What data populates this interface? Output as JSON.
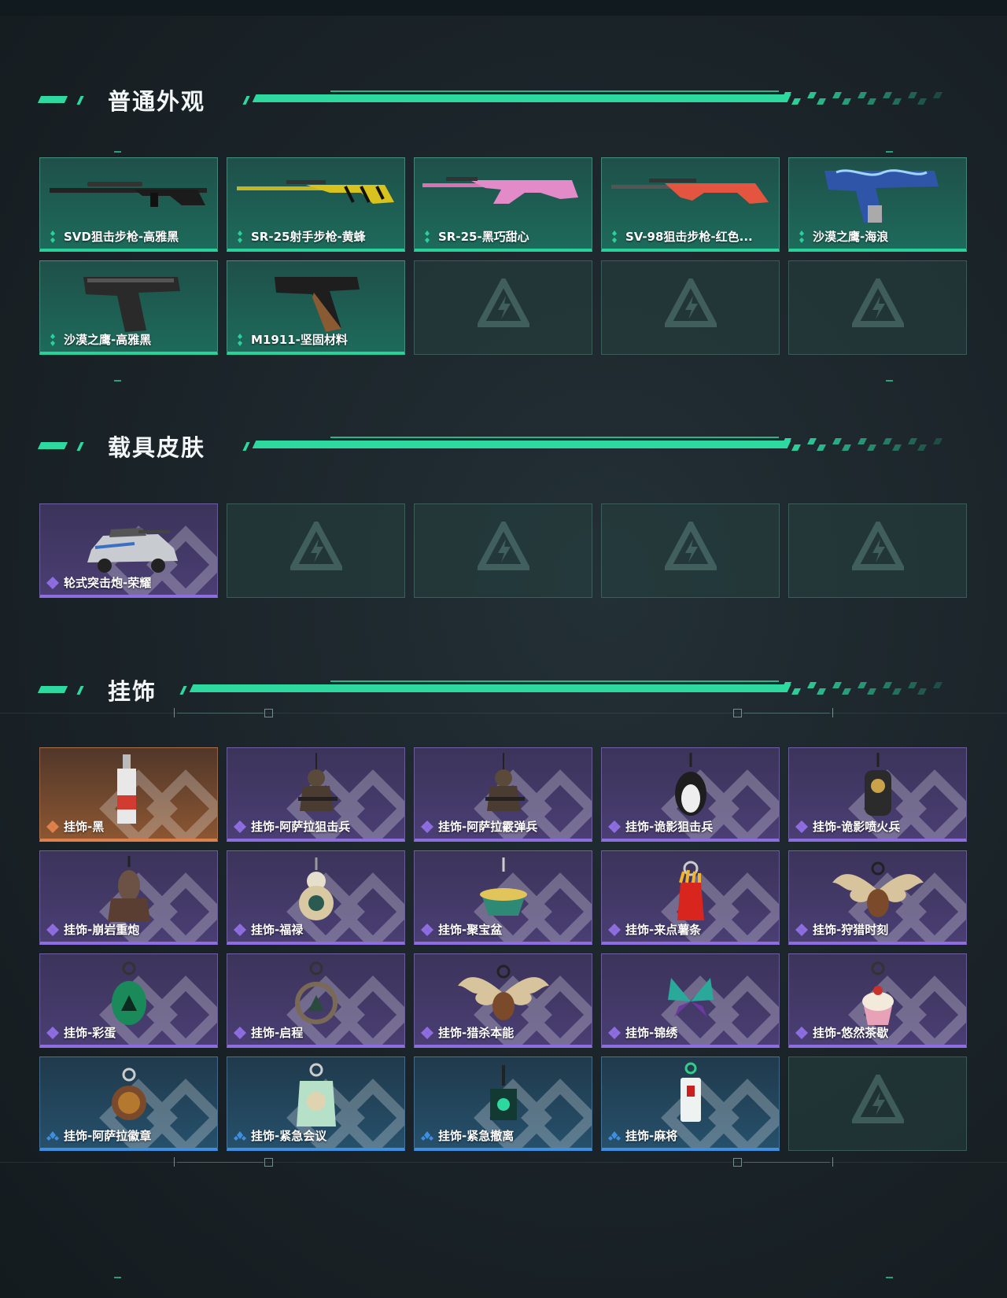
{
  "sections": [
    {
      "title": "普通外观",
      "items": [
        {
          "label": "SVD狙击步枪-高雅黑",
          "rarity": "green",
          "icon": "sniper-rifle-black"
        },
        {
          "label": "SR-25射手步枪-黄蜂",
          "rarity": "green",
          "icon": "rifle-yellow-hornet"
        },
        {
          "label": "SR-25-黑巧甜心",
          "rarity": "green",
          "icon": "rifle-pink"
        },
        {
          "label": "SV-98狙击步枪-红色...",
          "rarity": "green",
          "icon": "sniper-rifle-red"
        },
        {
          "label": "沙漠之鹰-海浪",
          "rarity": "green",
          "icon": "pistol-blue-wave"
        },
        {
          "label": "沙漠之鹰-高雅黑",
          "rarity": "green",
          "icon": "pistol-black"
        },
        {
          "label": "M1911-坚固材料",
          "rarity": "green",
          "icon": "pistol-m1911"
        },
        {
          "label": "",
          "rarity": "empty"
        },
        {
          "label": "",
          "rarity": "empty"
        },
        {
          "label": "",
          "rarity": "empty"
        }
      ]
    },
    {
      "title": "载具皮肤",
      "items": [
        {
          "label": "轮式突击炮-荣耀",
          "rarity": "purple",
          "icon": "armored-vehicle"
        },
        {
          "label": "",
          "rarity": "empty"
        },
        {
          "label": "",
          "rarity": "empty"
        },
        {
          "label": "",
          "rarity": "empty"
        },
        {
          "label": "",
          "rarity": "empty"
        }
      ]
    },
    {
      "title": "挂饰",
      "items": [
        {
          "label": "挂饰-黑",
          "rarity": "orange",
          "icon": "charm-tag"
        },
        {
          "label": "挂饰-阿萨拉狙击兵",
          "rarity": "purple",
          "icon": "charm-soldier"
        },
        {
          "label": "挂饰-阿萨拉霰弹兵",
          "rarity": "purple",
          "icon": "charm-soldier"
        },
        {
          "label": "挂饰-诡影狙击兵",
          "rarity": "purple",
          "icon": "charm-penguin"
        },
        {
          "label": "挂饰-诡影喷火兵",
          "rarity": "purple",
          "icon": "charm-flamer"
        },
        {
          "label": "挂饰-崩岩重炮",
          "rarity": "purple",
          "icon": "charm-heavy"
        },
        {
          "label": "挂饰-福禄",
          "rarity": "purple",
          "icon": "charm-gourd"
        },
        {
          "label": "挂饰-聚宝盆",
          "rarity": "purple",
          "icon": "charm-treasure-bowl"
        },
        {
          "label": "挂饰-来点薯条",
          "rarity": "purple",
          "icon": "charm-fries"
        },
        {
          "label": "挂饰-狩猎时刻",
          "rarity": "purple",
          "icon": "charm-antlers"
        },
        {
          "label": "挂饰-彩蛋",
          "rarity": "purple",
          "icon": "charm-egg"
        },
        {
          "label": "挂饰-启程",
          "rarity": "purple",
          "icon": "charm-ring"
        },
        {
          "label": "挂饰-猎杀本能",
          "rarity": "purple",
          "icon": "charm-antlers"
        },
        {
          "label": "挂饰-锦绣",
          "rarity": "purple",
          "icon": "charm-butterfly"
        },
        {
          "label": "挂饰-悠然茶歇",
          "rarity": "purple",
          "icon": "charm-cupcake"
        },
        {
          "label": "挂饰-阿萨拉徽章",
          "rarity": "blue",
          "icon": "charm-badge"
        },
        {
          "label": "挂饰-紧急会议",
          "rarity": "blue",
          "icon": "charm-acrylic"
        },
        {
          "label": "挂饰-紧急撤离",
          "rarity": "blue",
          "icon": "charm-square"
        },
        {
          "label": "挂饰-麻将",
          "rarity": "blue",
          "icon": "charm-mahjong"
        },
        {
          "label": "",
          "rarity": "empty"
        }
      ]
    }
  ],
  "colors": {
    "accent": "#2ed9a0",
    "green": "#27d39a",
    "purple": "#8e6de0",
    "orange": "#e0804a",
    "blue": "#3f8fe0"
  }
}
